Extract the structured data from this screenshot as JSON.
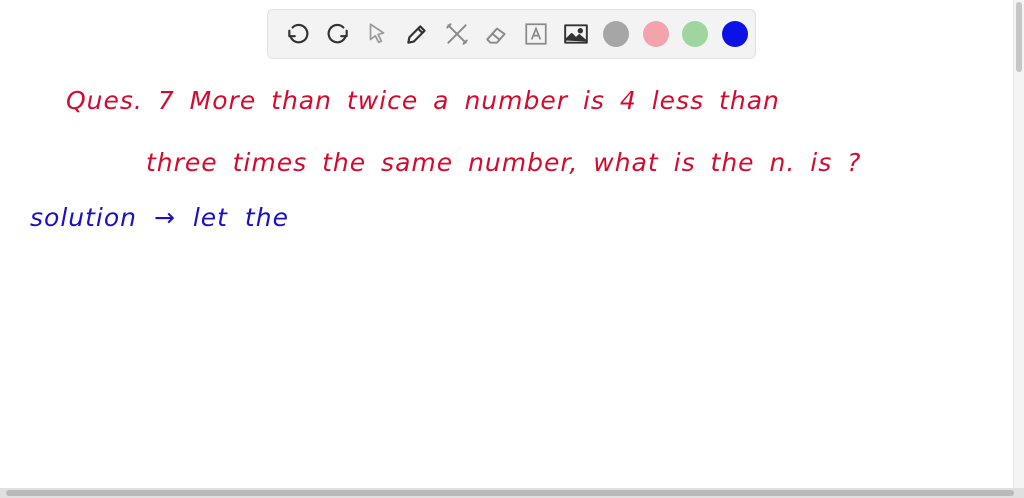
{
  "toolbar": {
    "tools": [
      {
        "name": "undo-icon"
      },
      {
        "name": "redo-icon"
      },
      {
        "name": "select-arrow-icon"
      },
      {
        "name": "pen-icon"
      },
      {
        "name": "tools-icon"
      },
      {
        "name": "eraser-icon"
      },
      {
        "name": "text-box-icon"
      },
      {
        "name": "image-icon"
      }
    ],
    "colors": [
      "#a6a6a6",
      "#f3a3ab",
      "#9fd59f",
      "#0a12e6"
    ]
  },
  "handwriting": {
    "line1": "Ques. 7 More than twice a number is 4 less than",
    "line2": "three times the same number, what is the n. is ?",
    "line3": "solution → let the",
    "line1_color": "#d40a2e",
    "line2_color": "#d40a2e",
    "line3_color": "#1a10c9"
  }
}
